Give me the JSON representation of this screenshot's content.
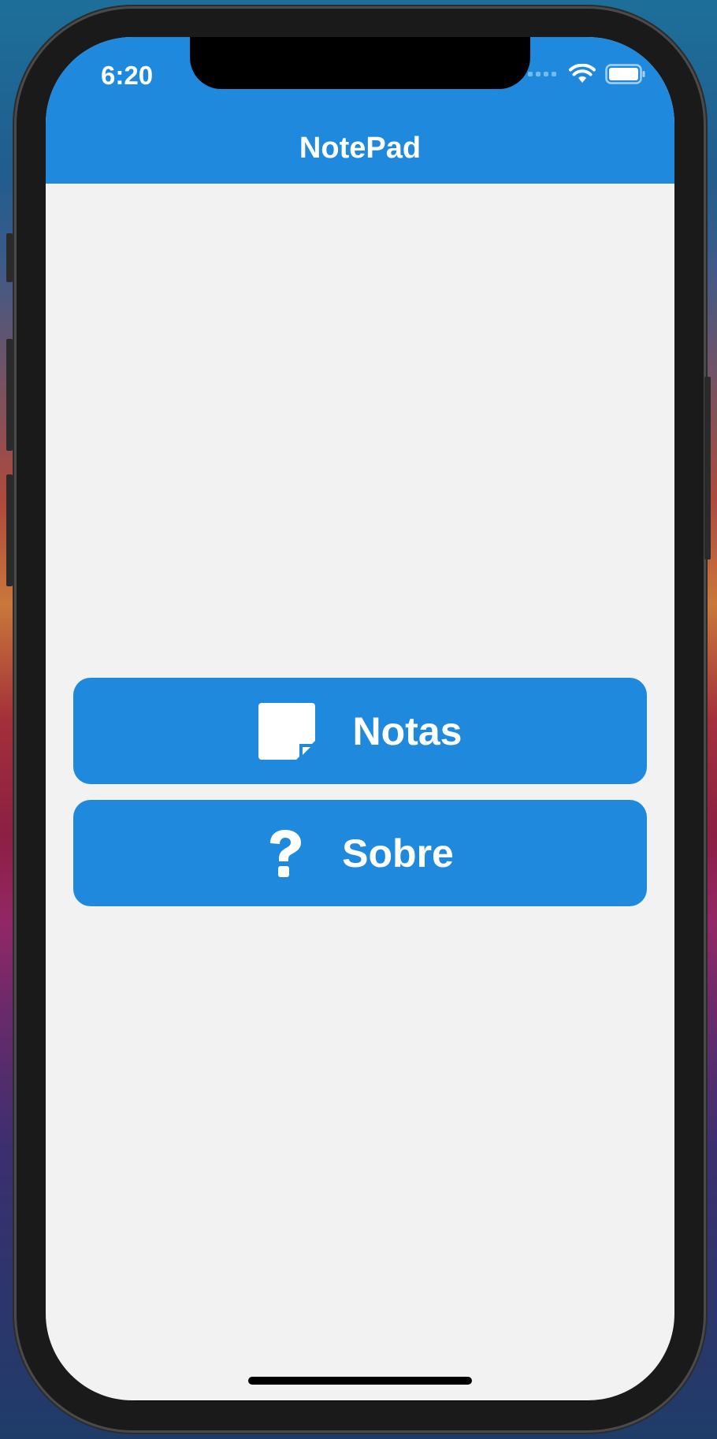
{
  "status_bar": {
    "time": "6:20",
    "wifi_icon": "wifi-icon",
    "battery_icon": "battery-icon",
    "signal_icon": "signal-dots-icon"
  },
  "header": {
    "title": "NotePad",
    "background": "#1f8add"
  },
  "menu": {
    "notas": {
      "label": "Notas",
      "icon": "sticky-note-icon"
    },
    "sobre": {
      "label": "Sobre",
      "icon": "question-mark-icon"
    }
  },
  "colors": {
    "accent": "#1f8add",
    "screen_background": "#f2f2f2",
    "text_on_accent": "#ffffff"
  }
}
